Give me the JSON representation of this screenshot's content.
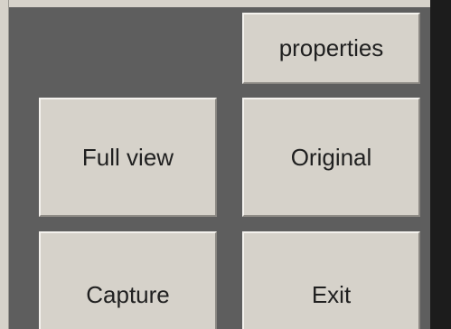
{
  "buttons": {
    "properties": "properties",
    "full_view": "Full view",
    "original": "Original",
    "capture": "Capture",
    "exit": "Exit"
  },
  "colors": {
    "panel_bg": "#5e5e5e",
    "button_face": "#d6d2ca",
    "button_text": "#202020",
    "right_edge": "#1c1c1c"
  }
}
